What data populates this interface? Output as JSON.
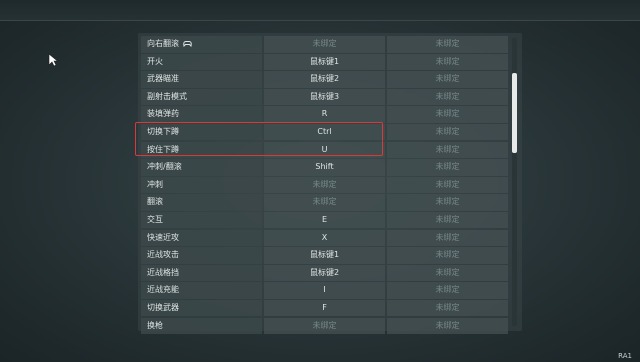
{
  "keybinds": {
    "rows": [
      {
        "action": "向右翻滚",
        "primary": "未绑定",
        "secondary": "未绑定",
        "primary_unbound": true,
        "has_icon": true
      },
      {
        "action": "开火",
        "primary": "鼠标键1",
        "secondary": "未绑定",
        "primary_unbound": false
      },
      {
        "action": "武器瞄准",
        "primary": "鼠标键2",
        "secondary": "未绑定",
        "primary_unbound": false
      },
      {
        "action": "副射击模式",
        "primary": "鼠标键3",
        "secondary": "未绑定",
        "primary_unbound": false
      },
      {
        "action": "装填弹药",
        "primary": "R",
        "secondary": "未绑定",
        "primary_unbound": false
      },
      {
        "action": "切换下蹲",
        "primary": "Ctrl",
        "secondary": "未绑定",
        "primary_unbound": false
      },
      {
        "action": "按住下蹲",
        "primary": "U",
        "secondary": "未绑定",
        "primary_unbound": false
      },
      {
        "action": "冲刺/翻滚",
        "primary": "Shift",
        "secondary": "未绑定",
        "primary_unbound": false
      },
      {
        "action": "冲刺",
        "primary": "未绑定",
        "secondary": "未绑定",
        "primary_unbound": true
      },
      {
        "action": "翻滚",
        "primary": "未绑定",
        "secondary": "未绑定",
        "primary_unbound": true
      },
      {
        "action": "交互",
        "primary": "E",
        "secondary": "未绑定",
        "primary_unbound": false
      },
      {
        "action": "快速近攻",
        "primary": "X",
        "secondary": "未绑定",
        "primary_unbound": false
      },
      {
        "action": "近战攻击",
        "primary": "鼠标键1",
        "secondary": "未绑定",
        "primary_unbound": false
      },
      {
        "action": "近战格挡",
        "primary": "鼠标键2",
        "secondary": "未绑定",
        "primary_unbound": false
      },
      {
        "action": "近战充能",
        "primary": "I",
        "secondary": "未绑定",
        "primary_unbound": false
      },
      {
        "action": "切换武器",
        "primary": "F",
        "secondary": "未绑定",
        "primary_unbound": false
      },
      {
        "action": "换枪",
        "primary": "未绑定",
        "secondary": "未绑定",
        "primary_unbound": true
      }
    ]
  },
  "scrollbar": {
    "position_fraction": 0.12,
    "visible_fraction": 0.28
  },
  "highlight": {
    "color": "#d83a3a",
    "rows": [
      "切换下蹲",
      "按住下蹲"
    ]
  },
  "watermark": "RA1",
  "colors": {
    "unbound_text": "#77888a",
    "bound_text": "#dfe4e4"
  }
}
